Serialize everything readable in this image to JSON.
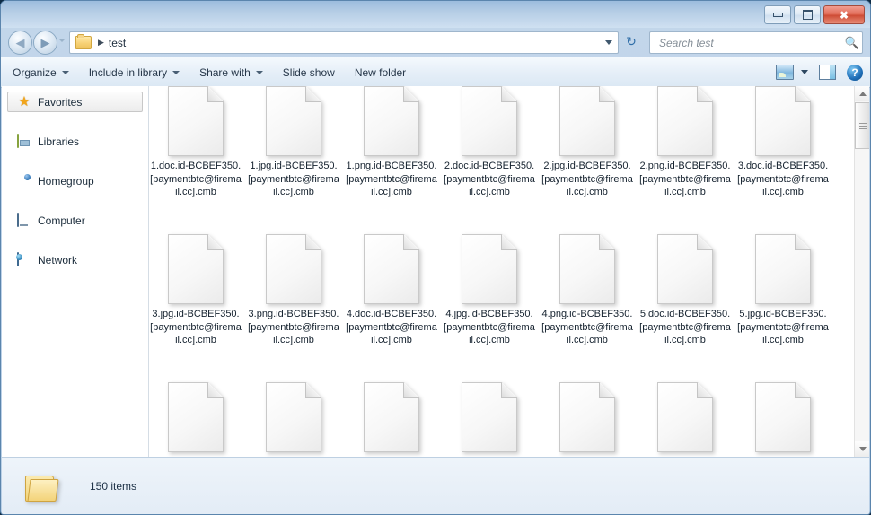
{
  "window": {
    "title": "",
    "controls": {
      "minimize_label": "Minimize",
      "maximize_label": "Maximize",
      "close_label": "✖"
    }
  },
  "navigation": {
    "back_label": "◀",
    "forward_label": "▶",
    "recent_pages_label": "Recent pages",
    "refresh_label": "↻"
  },
  "address": {
    "folder_icon": "folder-icon",
    "separator": "▶",
    "crumb": "test",
    "dropdown_label": "Previous locations"
  },
  "search": {
    "placeholder": "Search test",
    "value": "",
    "icon": "search-icon"
  },
  "toolbar": {
    "items": [
      {
        "label": "Organize",
        "has_menu": true
      },
      {
        "label": "Include in library",
        "has_menu": true
      },
      {
        "label": "Share with",
        "has_menu": true
      },
      {
        "label": "Slide show",
        "has_menu": false
      },
      {
        "label": "New folder",
        "has_menu": false
      }
    ],
    "view_icon": "change-view-icon",
    "view_dropdown": "view-options-chevron",
    "preview_pane_icon": "preview-pane-icon",
    "help_icon": "help-icon",
    "help_glyph": "?"
  },
  "sidebar": {
    "items": [
      {
        "label": "Favorites",
        "icon": "star-icon",
        "selected": true
      },
      {
        "label": "Libraries",
        "icon": "library-icon",
        "selected": false
      },
      {
        "label": "Homegroup",
        "icon": "homegroup-icon",
        "selected": false
      },
      {
        "label": "Computer",
        "icon": "computer-icon",
        "selected": false
      },
      {
        "label": "Network",
        "icon": "network-icon",
        "selected": false
      }
    ]
  },
  "files": {
    "icon_type": "blank-document-icon",
    "columns": 7,
    "items": [
      {
        "name": "1.doc.id-BCBEF350.[paymentbtc@firemail.cc].cmb"
      },
      {
        "name": "1.jpg.id-BCBEF350.[paymentbtc@firemail.cc].cmb"
      },
      {
        "name": "1.png.id-BCBEF350.[paymentbtc@firemail.cc].cmb"
      },
      {
        "name": "2.doc.id-BCBEF350.[paymentbtc@firemail.cc].cmb"
      },
      {
        "name": "2.jpg.id-BCBEF350.[paymentbtc@firemail.cc].cmb"
      },
      {
        "name": "2.png.id-BCBEF350.[paymentbtc@firemail.cc].cmb"
      },
      {
        "name": "3.doc.id-BCBEF350.[paymentbtc@firemail.cc].cmb"
      },
      {
        "name": "3.jpg.id-BCBEF350.[paymentbtc@firemail.cc].cmb"
      },
      {
        "name": "3.png.id-BCBEF350.[paymentbtc@firemail.cc].cmb"
      },
      {
        "name": "4.doc.id-BCBEF350.[paymentbtc@firemail.cc].cmb"
      },
      {
        "name": "4.jpg.id-BCBEF350.[paymentbtc@firemail.cc].cmb"
      },
      {
        "name": "4.png.id-BCBEF350.[paymentbtc@firemail.cc].cmb"
      },
      {
        "name": "5.doc.id-BCBEF350.[paymentbtc@firemail.cc].cmb"
      },
      {
        "name": "5.jpg.id-BCBEF350.[paymentbtc@firemail.cc].cmb"
      },
      {
        "name": ""
      },
      {
        "name": ""
      },
      {
        "name": ""
      },
      {
        "name": ""
      },
      {
        "name": ""
      },
      {
        "name": ""
      },
      {
        "name": ""
      }
    ]
  },
  "scrollbar": {
    "up_label": "Scroll up",
    "down_label": "Scroll down",
    "thumb_label": "Vertical scroll thumb"
  },
  "status": {
    "folder_icon": "open-folder-icon",
    "item_count_text": "150 items"
  },
  "colors": {
    "accent": "#2f6ea8",
    "window_frame": "#b9cfe6",
    "close_button": "#cd4a33",
    "content_bg": "#ffffff"
  }
}
